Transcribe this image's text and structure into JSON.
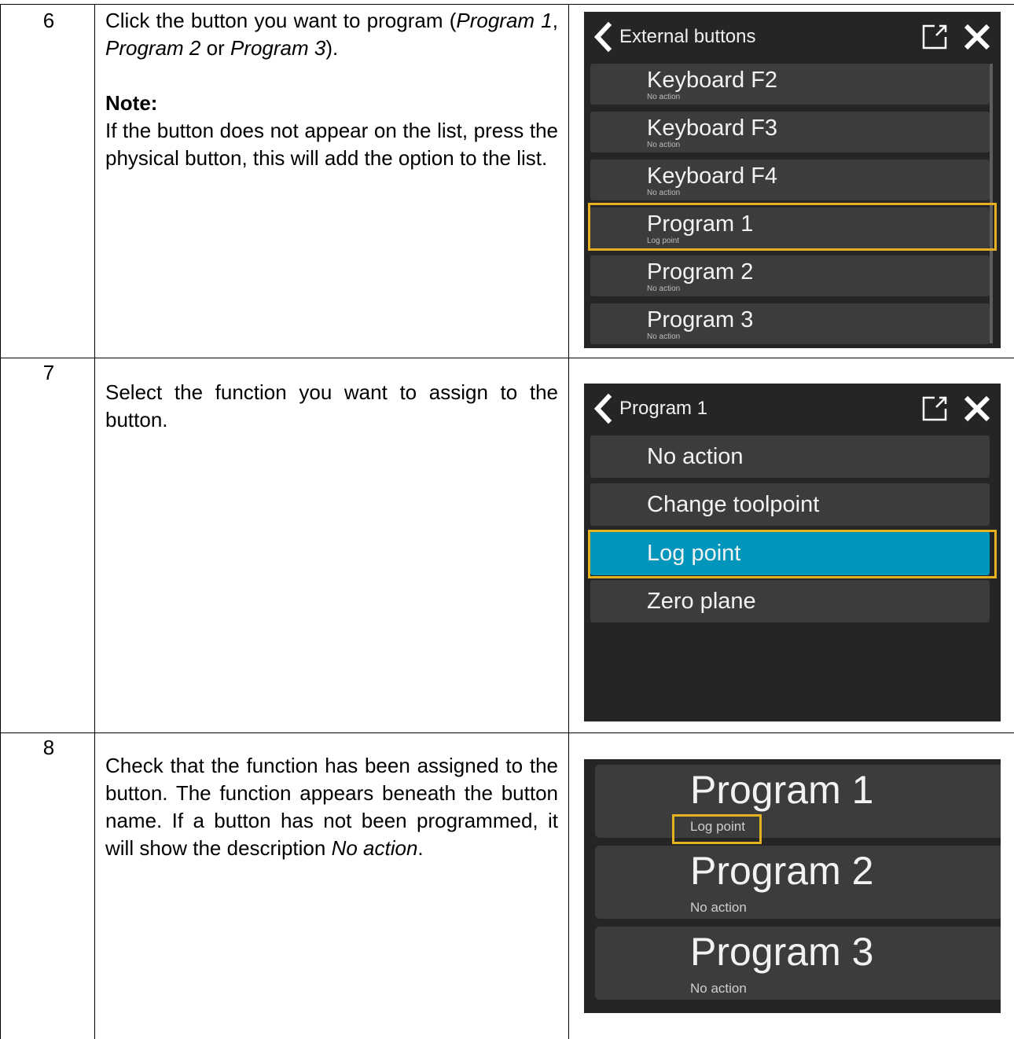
{
  "steps": [
    {
      "number": "6",
      "instruction": {
        "part1": "Click the button you want to program (",
        "p1": "Program 1",
        "sep1": ", ",
        "p2": "Program 2",
        "sep2": " or ",
        "p3": "Program 3",
        "part2": ").",
        "note_label": "Note:",
        "note_text": "If the button does not appear on the list, press the physical button, this will add the option to the list."
      },
      "screen": {
        "title": "External buttons",
        "icons": [
          "back-chevron-icon",
          "external-window-icon",
          "close-icon"
        ],
        "items": [
          {
            "label": "Keyboard F2",
            "sub": "No action"
          },
          {
            "label": "Keyboard F3",
            "sub": "No action"
          },
          {
            "label": "Keyboard F4",
            "sub": "No action"
          },
          {
            "label": "Program 1",
            "sub": "Log point",
            "highlighted": true
          },
          {
            "label": "Program 2",
            "sub": "No action"
          },
          {
            "label": "Program 3",
            "sub": "No action"
          }
        ]
      }
    },
    {
      "number": "7",
      "instruction": {
        "text": "Select the function you want to assign to the button."
      },
      "screen": {
        "title": "Program 1",
        "icons": [
          "back-chevron-icon",
          "external-window-icon",
          "close-icon"
        ],
        "items": [
          {
            "label": "No action"
          },
          {
            "label": "Change toolpoint"
          },
          {
            "label": "Log point",
            "selected": true,
            "highlighted": true
          },
          {
            "label": "Zero plane"
          }
        ]
      }
    },
    {
      "number": "8",
      "instruction": {
        "part1": "Check that the function has been assigned to the button. The function appears beneath the button name. If a button has not been programmed, it will show the description ",
        "em": "No action",
        "part2": "."
      },
      "screen": {
        "items": [
          {
            "label": "Program 1",
            "sub": "Log point",
            "highlighted": true
          },
          {
            "label": "Program 2",
            "sub": "No action"
          },
          {
            "label": "Program 3",
            "sub": "No action"
          }
        ]
      }
    }
  ],
  "colors": {
    "panel_bg": "#252526",
    "row_bg": "#3c3c3c",
    "selected_bg": "#0096bb",
    "highlight": "#e5b21f",
    "text": "#f2f2f2"
  }
}
